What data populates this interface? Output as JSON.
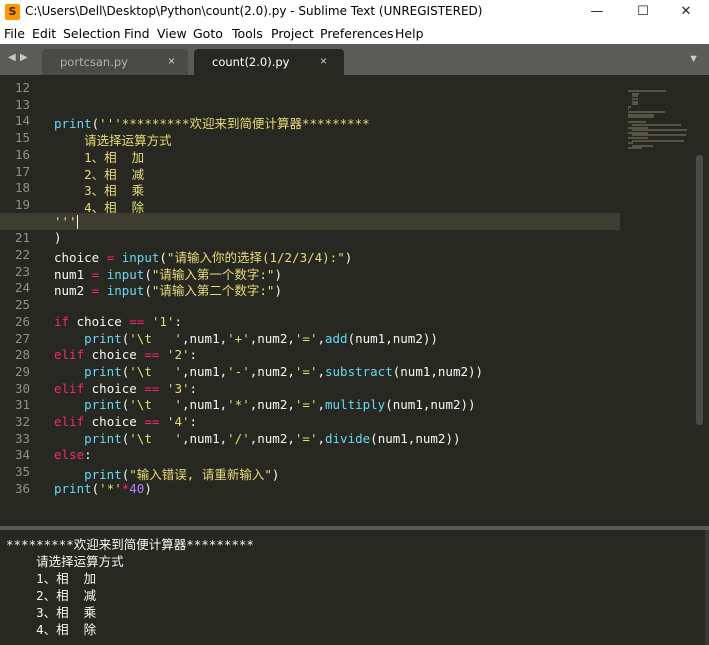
{
  "window": {
    "title": "C:\\Users\\Dell\\Desktop\\Python\\count(2.0).py - Sublime Text (UNREGISTERED)",
    "app_icon": "sublime-text-icon",
    "minimize_glyph": "—",
    "maximize_glyph": "☐",
    "close_glyph": "✕"
  },
  "menu": [
    "File",
    "Edit",
    "Selection",
    "Find",
    "View",
    "Goto",
    "Tools",
    "Project",
    "Preferences",
    "Help"
  ],
  "tabs": [
    {
      "label": "portcsan.py",
      "active": false
    },
    {
      "label": "count(2.0).py",
      "active": true
    }
  ],
  "tab_glyphs": {
    "back": "◀",
    "forward": "▶",
    "close": "×",
    "dropdown": "▼"
  },
  "editor": {
    "current_line": 20,
    "line_numbers": [
      "12",
      "13",
      "14",
      "15",
      "16",
      "17",
      "18",
      "19",
      "20",
      "21",
      "22",
      "23",
      "24",
      "25",
      "26",
      "27",
      "28",
      "29",
      "30",
      "31",
      "32",
      "33",
      "34",
      "35",
      "36"
    ],
    "lines": [
      "",
      "",
      "print('''*********欢迎来到简便计算器*********",
      "    请选择运算方式",
      "    1、相  加",
      "    2、相  减",
      "    3、相  乘",
      "    4、相  除",
      "'''",
      ")",
      "choice = input(\"请输入你的选择(1/2/3/4):\")",
      "num1 = input(\"请输入第一个数字:\")",
      "num2 = input(\"请输入第二个数字:\")",
      "",
      "if choice == '1':",
      "    print('\\t   ',num1,'+',num2,'=',add(num1,num2))",
      "elif choice == '2':",
      "    print('\\t   ',num1,'-',num2,'=',substract(num1,num2))",
      "elif choice == '3':",
      "    print('\\t   ',num1,'*',num2,'=',multiply(num1,num2))",
      "elif choice == '4':",
      "    print('\\t   ',num1,'/',num2,'=',divide(num1,num2))",
      "else:",
      "    print(\"输入错误, 请重新输入\")",
      "print('*'*40)"
    ]
  },
  "console": {
    "lines": [
      "*********欢迎来到简便计算器*********",
      "    请选择运算方式",
      "    1、相  加",
      "    2、相  减",
      "    3、相  乘",
      "    4、相  除"
    ]
  },
  "colors": {
    "editor_bg": "#272822",
    "keyword": "#f92672",
    "function": "#66d9ef",
    "string": "#e6db74",
    "number": "#ae81ff",
    "plain": "#f8f8f2",
    "tabbar_bg": "#5b5c57"
  }
}
